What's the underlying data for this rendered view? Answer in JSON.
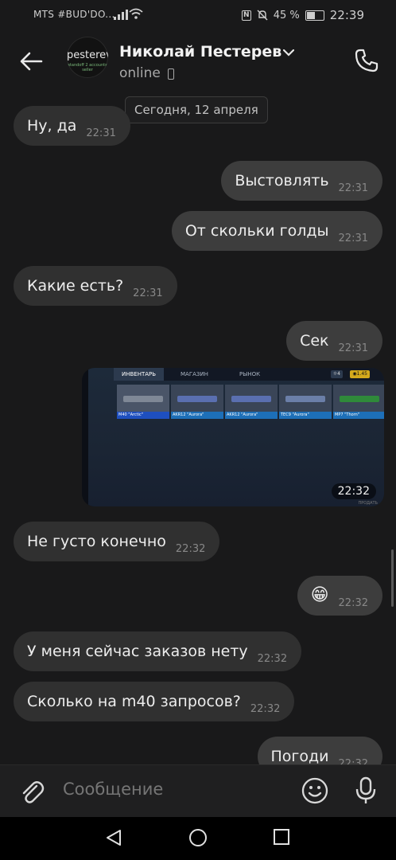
{
  "status_bar": {
    "carrier": "MTS #BUD'DO...",
    "battery": "45 %",
    "time": "22:39"
  },
  "header": {
    "avatar_title": "pesterev",
    "avatar_subtitle": "standoff 2 accounts seller",
    "contact_name": "Николай Пестерев",
    "status": "online"
  },
  "date_separator": "Сегодня, 12 апреля",
  "messages": [
    {
      "text": "Ну, да",
      "time": "22:31",
      "direction": "in"
    },
    {
      "text": "Выстовлять",
      "time": "22:31",
      "direction": "out"
    },
    {
      "text": "От скольки голды",
      "time": "22:31",
      "direction": "out"
    },
    {
      "text": "Какие есть?",
      "time": "22:31",
      "direction": "in"
    },
    {
      "text": "Сек",
      "time": "22:31",
      "direction": "out"
    },
    {
      "text": "Не густо конечно",
      "time": "22:32",
      "direction": "in"
    },
    {
      "text": "😁",
      "time": "22:32",
      "direction": "out"
    },
    {
      "text": "У меня сейчас заказов нету",
      "time": "22:32",
      "direction": "in"
    },
    {
      "text": "Сколько на m40 запросов?",
      "time": "22:32",
      "direction": "in"
    },
    {
      "text": "Погоди",
      "time": "22:32",
      "direction": "out"
    }
  ],
  "photo_message": {
    "time": "22:32",
    "tabs": [
      "ИНВЕНТАРЬ",
      "МАГАЗИН",
      "РЫНОК"
    ],
    "weapons": [
      "M40 \"Arctic\"",
      "AKR12 \"Aurora\"",
      "AKR12 \"Aurora\"",
      "TEC9 \"Aurora\"",
      "MP7 \"Thorn\""
    ],
    "footer": "ПРОДАТЬ"
  },
  "composer": {
    "placeholder": "Сообщение"
  },
  "colors": {
    "background": "#19191a",
    "incoming_bubble": "#303030",
    "outgoing_bubble": "#3d3d3d"
  },
  "icons": [
    "back-arrow-icon",
    "chevron-down-icon",
    "phone-call-icon",
    "paperclip-icon",
    "emoji-icon",
    "microphone-icon",
    "nav-back-icon",
    "nav-home-icon",
    "nav-recents-icon"
  ]
}
